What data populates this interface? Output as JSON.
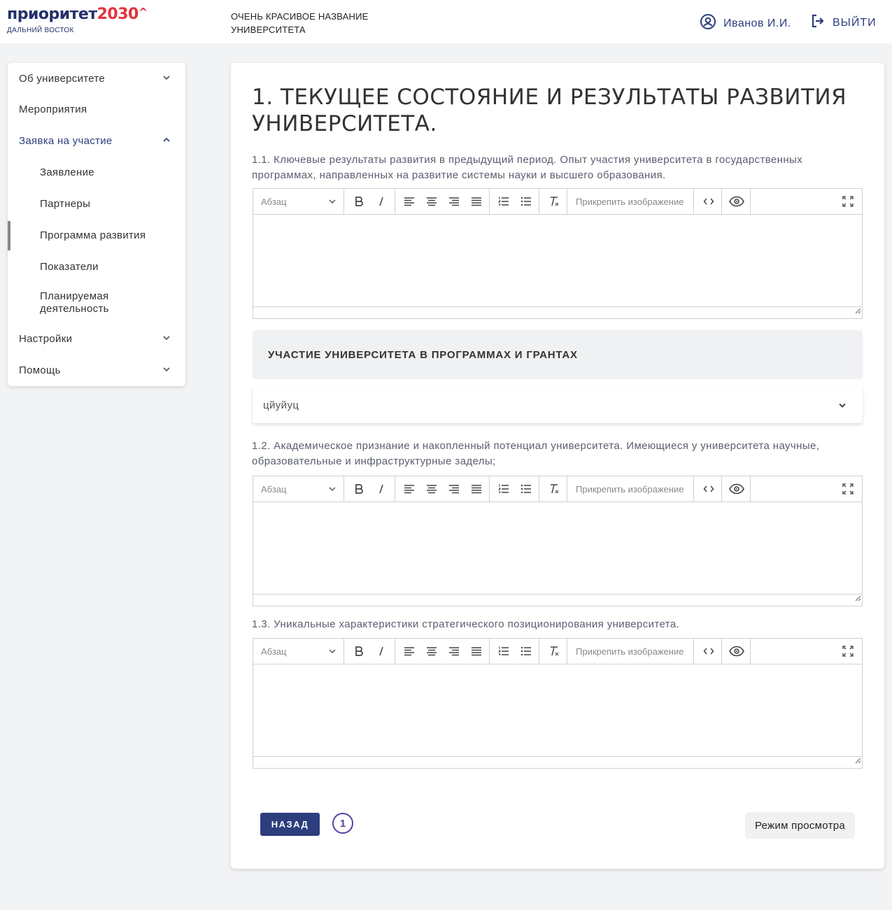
{
  "header": {
    "logo_main": "приоритет",
    "logo_num": "2030",
    "logo_caret": "^",
    "logo_sub": "ДАЛЬНИЙ ВОСТОК",
    "university_name": "ОЧЕНЬ КРАСИВОЕ НАЗВАНИЕ УНИВЕРСИТЕТА",
    "user_name": "Иванов И.И.",
    "logout_label": "ВЫЙТИ"
  },
  "sidebar": {
    "items": [
      {
        "label": "Об университете",
        "expandable": true,
        "expanded": false
      },
      {
        "label": "Мероприятия"
      },
      {
        "label": "Заявка на участие",
        "expandable": true,
        "expanded": true,
        "active": true
      },
      {
        "label": "Настройки",
        "expandable": true,
        "expanded": false
      },
      {
        "label": "Помощь",
        "expandable": true,
        "expanded": false
      }
    ],
    "subitems": [
      {
        "label": "Заявление"
      },
      {
        "label": "Партнеры"
      },
      {
        "label": "Программа развития",
        "current": true
      },
      {
        "label": "Показатели"
      },
      {
        "label": "Планируемая деятельность"
      }
    ]
  },
  "main": {
    "title": "1. ТЕКУЩЕЕ СОСТОЯНИЕ И РЕЗУЛЬТАТЫ РАЗВИТИЯ УНИВЕРСИТЕТА.",
    "questions": [
      {
        "label": "1.1. Ключевые результаты развития в предыдущий период. Опыт участия университета в государственных программах, направленных на развитие системы науки и высшего образования."
      },
      {
        "label": "1.2. Академическое признание и накопленный потенциал университета. Имеющиеся у университета научные, образовательные и инфраструктурные заделы;"
      },
      {
        "label": "1.3. Уникальные характеристики стратегического позиционирования университета."
      }
    ],
    "editor_toolbar": {
      "format_select": "Абзац",
      "attach_image": "Прикрепить изображение"
    },
    "section_heading": "УЧАСТИЕ УНИВЕРСИТЕТА В ПРОГРАММАХ И ГРАНТАХ",
    "accordion_item": "цйуйуц",
    "back_button": "НАЗАД",
    "step_number": "1",
    "view_mode_button": "Режим просмотра"
  },
  "colors": {
    "brand_blue": "#2d3e7e",
    "brand_red": "#e4323c",
    "step_purple": "#5b3fa3"
  }
}
